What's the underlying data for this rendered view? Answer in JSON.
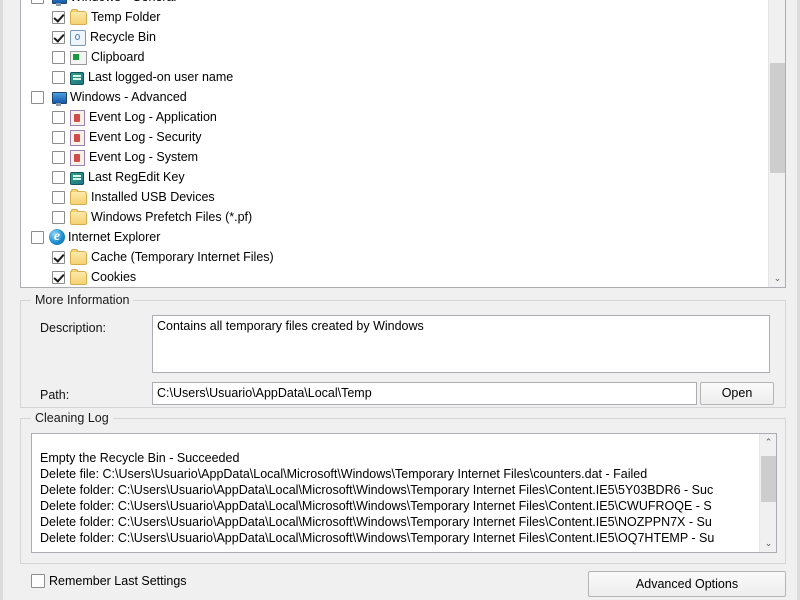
{
  "tree": {
    "items": [
      {
        "label": "Windows - General",
        "level": 0,
        "checked": false,
        "icon": "monitor-icon",
        "partial_top": true
      },
      {
        "label": "Temp Folder",
        "level": 1,
        "checked": true,
        "icon": "folder-icon"
      },
      {
        "label": "Recycle Bin",
        "level": 1,
        "checked": true,
        "icon": "recycle-bin-icon"
      },
      {
        "label": "Clipboard",
        "level": 1,
        "checked": false,
        "icon": "clipboard-icon"
      },
      {
        "label": "Last logged-on user name",
        "level": 1,
        "checked": false,
        "icon": "registry-key-icon"
      },
      {
        "label": "Windows - Advanced",
        "level": 0,
        "checked": false,
        "icon": "monitor-icon"
      },
      {
        "label": "Event Log - Application",
        "level": 1,
        "checked": false,
        "icon": "event-log-icon"
      },
      {
        "label": "Event Log - Security",
        "level": 1,
        "checked": false,
        "icon": "event-log-icon"
      },
      {
        "label": "Event Log - System",
        "level": 1,
        "checked": false,
        "icon": "event-log-icon"
      },
      {
        "label": "Last RegEdit Key",
        "level": 1,
        "checked": false,
        "icon": "registry-key-icon"
      },
      {
        "label": "Installed USB Devices",
        "level": 1,
        "checked": false,
        "icon": "folder-icon"
      },
      {
        "label": "Windows Prefetch Files (*.pf)",
        "level": 1,
        "checked": false,
        "icon": "folder-icon"
      },
      {
        "label": "Internet Explorer",
        "level": 0,
        "checked": false,
        "icon": "internet-explorer-icon"
      },
      {
        "label": "Cache (Temporary Internet Files)",
        "level": 1,
        "checked": true,
        "icon": "folder-icon"
      },
      {
        "label": "Cookies",
        "level": 1,
        "checked": true,
        "icon": "folder-icon"
      }
    ],
    "scrollbar": {
      "up_arrow": "⌃",
      "down_arrow": "⌄"
    }
  },
  "more_information": {
    "legend": "More Information",
    "description_label": "Description:",
    "description_value": "Contains all temporary files created by Windows",
    "path_label": "Path:",
    "path_value": "C:\\Users\\Usuario\\AppData\\Local\\Temp",
    "open_button": "Open"
  },
  "cleaning_log": {
    "legend": "Cleaning Log",
    "lines": [
      "Empty the Recycle Bin  -  Succeeded",
      "Delete file: C:\\Users\\Usuario\\AppData\\Local\\Microsoft\\Windows\\Temporary Internet Files\\counters.dat  -  Failed",
      "Delete folder: C:\\Users\\Usuario\\AppData\\Local\\Microsoft\\Windows\\Temporary Internet Files\\Content.IE5\\5Y03BDR6  -  Suc",
      "Delete folder: C:\\Users\\Usuario\\AppData\\Local\\Microsoft\\Windows\\Temporary Internet Files\\Content.IE5\\CWUFROQE  -  S",
      "Delete folder: C:\\Users\\Usuario\\AppData\\Local\\Microsoft\\Windows\\Temporary Internet Files\\Content.IE5\\NOZPPN7X  -  Su",
      "Delete folder: C:\\Users\\Usuario\\AppData\\Local\\Microsoft\\Windows\\Temporary Internet Files\\Content.IE5\\OQ7HTEMP  -  Su"
    ],
    "scrollbar": {
      "up_arrow": "⌃",
      "down_arrow": "⌄"
    }
  },
  "footer": {
    "remember_label": "Remember Last Settings",
    "remember_checked": false,
    "advanced_options_button": "Advanced Options"
  },
  "colors": {
    "window_bg": "#f0f0f0",
    "panel_bg": "#ffffff",
    "border": "#abadb3",
    "group_border": "#d5d5d5",
    "scroll_thumb": "#cdcdcd"
  }
}
